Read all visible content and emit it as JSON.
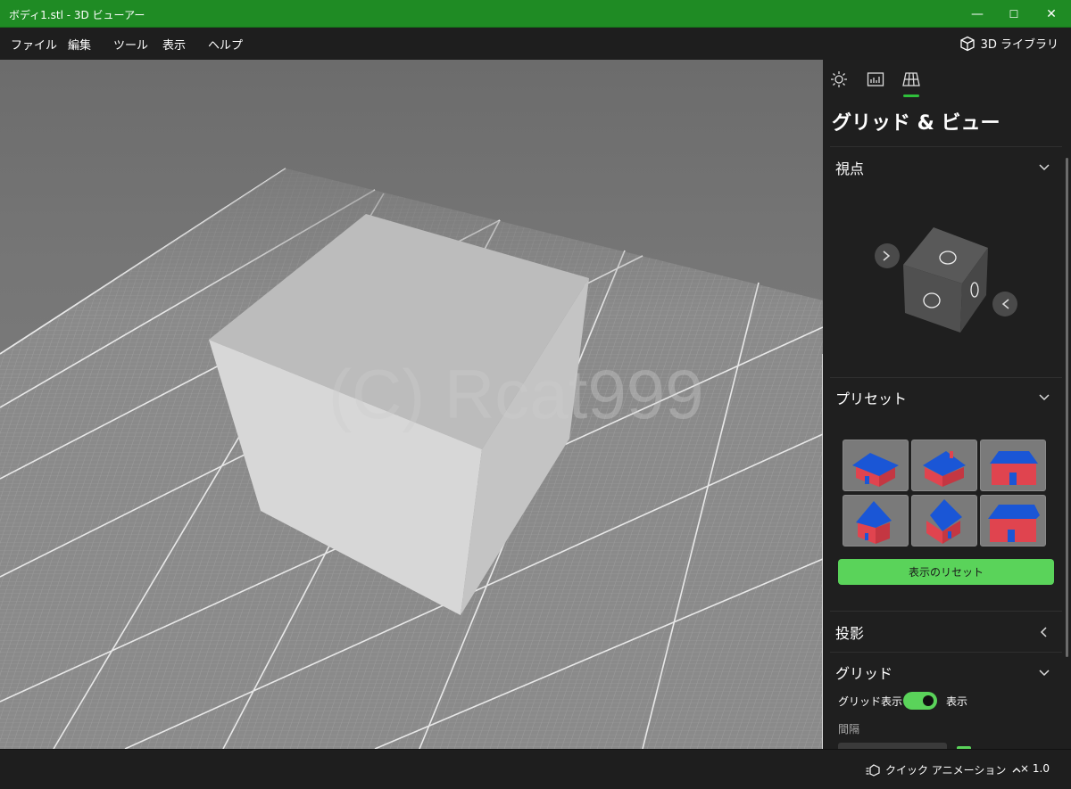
{
  "window": {
    "title": "ボディ1.stl - 3D ビューアー",
    "minimize_glyph": "—",
    "maximize_glyph": "☐",
    "close_glyph": "✕"
  },
  "menu": {
    "items": [
      "ファイル",
      "編集",
      "ツール",
      "表示",
      "ヘルプ"
    ],
    "library_label": "3D ライブラリ",
    "library_icon": "3d-cube-icon"
  },
  "viewport": {
    "watermark": "(C) Rcat999",
    "model": "cube"
  },
  "panel": {
    "tabs": [
      {
        "icon": "lighting-icon"
      },
      {
        "icon": "stats-icon"
      },
      {
        "icon": "grid-icon",
        "selected": true
      }
    ],
    "title": "グリッド & ビュー",
    "sections": {
      "viewpoint": {
        "title": "視点",
        "expanded": true
      },
      "presets": {
        "title": "プリセット",
        "expanded": true,
        "count": 6,
        "reset_label": "表示のリセット"
      },
      "projection": {
        "title": "投影",
        "expanded": false
      },
      "grid": {
        "title": "グリッド",
        "expanded": true,
        "show_label": "グリッド表示",
        "show_state": "表示",
        "show_on": true,
        "spacing_label": "間隔"
      }
    }
  },
  "bottom": {
    "quick_animation": "クイック アニメーション",
    "quick_animation_icon": "cube-play-icon",
    "speed": "× 1.0"
  },
  "colors": {
    "titlebar": "#1f8b24",
    "accent": "#5ad35a",
    "panel_bg": "#1f1f1f"
  }
}
